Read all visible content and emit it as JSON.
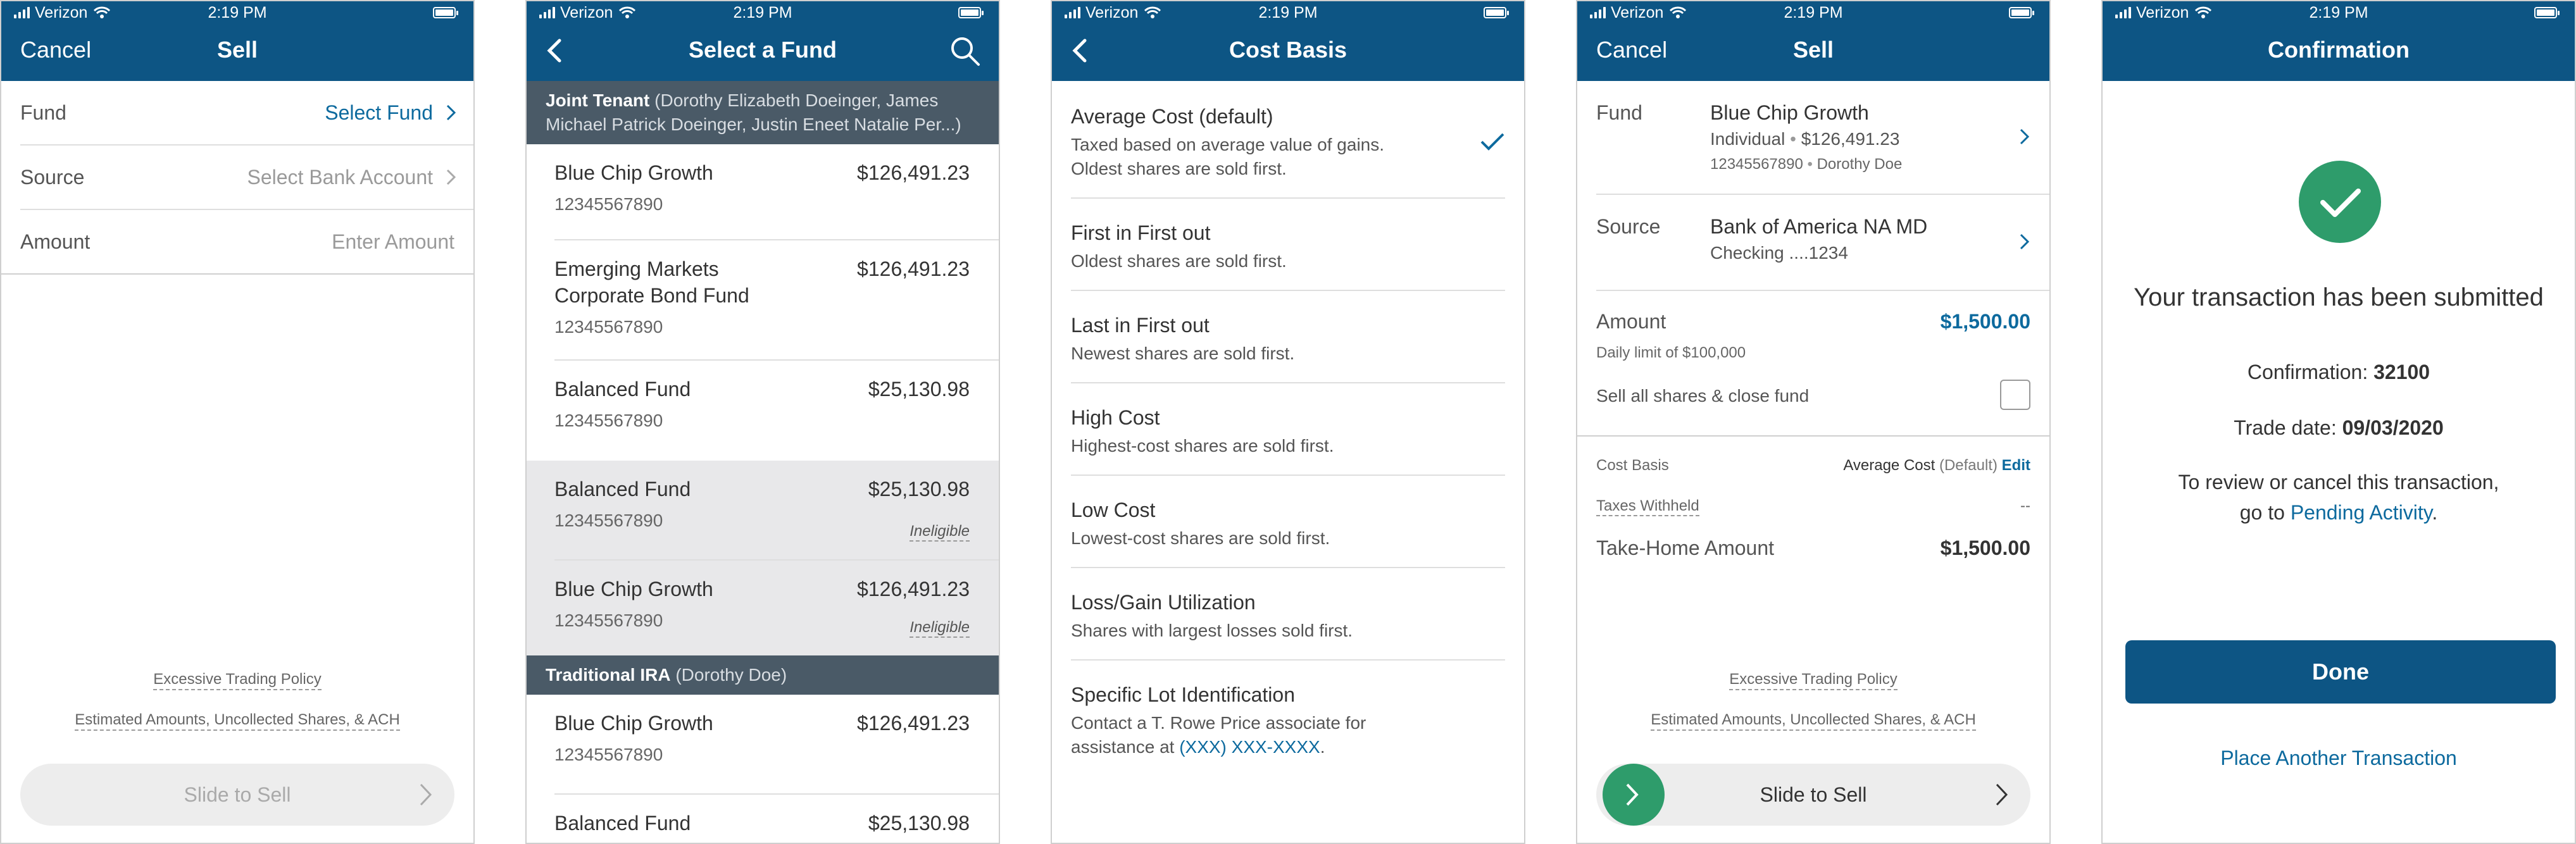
{
  "status": {
    "carrier": "Verizon",
    "time": "2:19 PM"
  },
  "colors": {
    "brand": "#0d5584",
    "link": "#0d6a9e",
    "success": "#2e9c6b",
    "section_bg": "#4a5a67"
  },
  "screen1": {
    "cancel": "Cancel",
    "title": "Sell",
    "rows": [
      {
        "label": "Fund",
        "value": "Select Fund"
      },
      {
        "label": "Source",
        "value": "Select Bank Account"
      },
      {
        "label": "Amount",
        "value": "Enter Amount"
      }
    ],
    "links": [
      "Excessive Trading Policy",
      "Estimated Amounts, Uncollected Shares, & ACH"
    ],
    "slider": "Slide to Sell"
  },
  "screen2": {
    "title": "Select a Fund",
    "section1": {
      "title": "Joint Tenant",
      "owners": "(Dorothy Elizabeth Doeinger, James Michael Patrick Doeinger, Justin Eneet Natalie Per...)"
    },
    "funds1": [
      {
        "name": "Blue Chip Growth",
        "amount": "$126,491.23",
        "account": "12345567890"
      },
      {
        "name": "Emerging Markets Corporate Bond Fund",
        "amount": "$126,491.23",
        "account": "12345567890"
      },
      {
        "name": "Balanced Fund",
        "amount": "$25,130.98",
        "account": "12345567890"
      },
      {
        "name": "Balanced Fund",
        "amount": "$25,130.98",
        "account": "12345567890",
        "status": "Ineligible"
      },
      {
        "name": "Blue Chip Growth",
        "amount": "$126,491.23",
        "account": "12345567890",
        "status": "Ineligible"
      }
    ],
    "section2": {
      "title": "Traditional IRA",
      "owners": "(Dorothy Doe)"
    },
    "funds2": [
      {
        "name": "Blue Chip Growth",
        "amount": "$126,491.23",
        "account": "12345567890"
      },
      {
        "name": "Balanced Fund",
        "amount": "$25,130.98",
        "account": ""
      }
    ]
  },
  "screen3": {
    "title": "Cost Basis",
    "options": [
      {
        "title": "Average Cost (default)",
        "desc": "Taxed based on average value of gains. Oldest shares are sold first.",
        "selected": true
      },
      {
        "title": "First in First out",
        "desc": "Oldest shares are sold first."
      },
      {
        "title": "Last in First out",
        "desc": "Newest shares are sold first."
      },
      {
        "title": "High Cost",
        "desc": "Highest-cost shares are sold first."
      },
      {
        "title": "Low Cost",
        "desc": "Lowest-cost shares are sold first."
      },
      {
        "title": "Loss/Gain Utilization",
        "desc": "Shares with largest losses sold first."
      },
      {
        "title": "Specific Lot Identification",
        "desc": "Contact a T. Rowe Price associate for assistance at",
        "phone": "(XXX) XXX-XXXX",
        "end": "."
      }
    ]
  },
  "screen4": {
    "cancel": "Cancel",
    "title": "Sell",
    "fund": {
      "label": "Fund",
      "name": "Blue Chip Growth",
      "type": "Individual",
      "amount": "$126,491.23",
      "account": "12345567890",
      "owner": "Dorothy Doe"
    },
    "source": {
      "label": "Source",
      "bank": "Bank of America NA MD",
      "account": "Checking ....1234"
    },
    "amount": {
      "label": "Amount",
      "value": "$1,500.00",
      "limit": "Daily limit of $100,000"
    },
    "sell_all": "Sell all shares & close fund",
    "cost_basis": {
      "label": "Cost Basis",
      "value": "Average Cost",
      "default": "(Default)",
      "edit": "Edit"
    },
    "taxes": {
      "label": "Taxes Withheld",
      "value": "--"
    },
    "take_home": {
      "label": "Take-Home Amount",
      "value": "$1,500.00"
    },
    "links": [
      "Excessive Trading Policy",
      "Estimated Amounts, Uncollected Shares, & ACH"
    ],
    "slider": "Slide to Sell"
  },
  "screen5": {
    "title": "Confirmation",
    "message": "Your transaction has been submitted",
    "conf_label": "Confirmation:",
    "conf_value": "32100",
    "trade_label": "Trade date:",
    "trade_value": "09/03/2020",
    "review_line1": "To review or cancel this transaction,",
    "review_line2": "go to",
    "pending": "Pending Activity",
    "period": ".",
    "done": "Done",
    "another": "Place Another Transaction"
  }
}
